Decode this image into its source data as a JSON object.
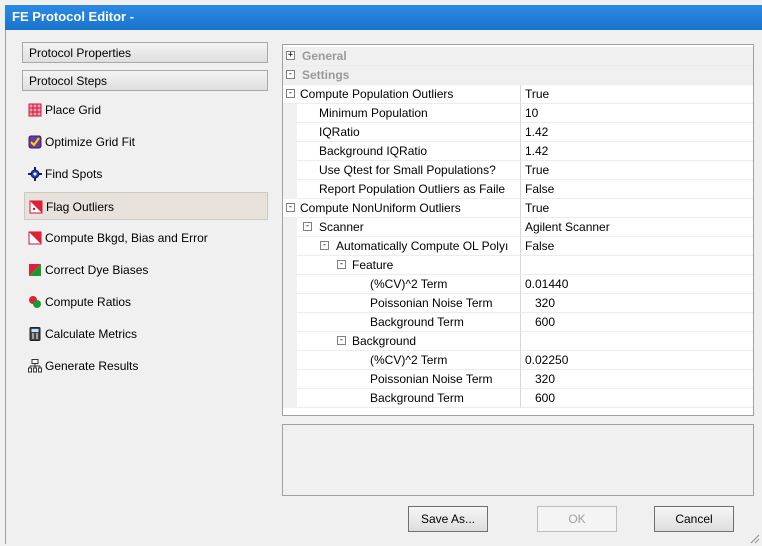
{
  "window": {
    "title": "FE Protocol Editor -"
  },
  "left_panel": {
    "protocol_properties": "Protocol Properties",
    "protocol_steps": "Protocol Steps",
    "steps": [
      {
        "label": "Place Grid",
        "icon": "place-grid-icon",
        "selected": false
      },
      {
        "label": "Optimize Grid Fit",
        "icon": "optimize-grid-icon",
        "selected": false
      },
      {
        "label": "Find Spots",
        "icon": "find-spots-icon",
        "selected": false
      },
      {
        "label": "Flag Outliers",
        "icon": "flag-outliers-icon",
        "selected": true
      },
      {
        "label": "Compute Bkgd, Bias and Error",
        "icon": "compute-bkgd-icon",
        "selected": false
      },
      {
        "label": "Correct Dye Biases",
        "icon": "correct-dye-icon",
        "selected": false
      },
      {
        "label": "Compute Ratios",
        "icon": "compute-ratios-icon",
        "selected": false
      },
      {
        "label": "Calculate Metrics",
        "icon": "calculate-metrics-icon",
        "selected": false
      },
      {
        "label": "Generate Results",
        "icon": "generate-results-icon",
        "selected": false
      }
    ]
  },
  "grid": {
    "rows": [
      {
        "name": "General",
        "value": "",
        "type": "category",
        "toggle": "+"
      },
      {
        "name": "Settings",
        "value": "",
        "type": "category",
        "toggle": "-"
      },
      {
        "name": "Compute Population Outliers",
        "value": "True",
        "toggle": "-"
      },
      {
        "name": "Minimum Population",
        "value": "10"
      },
      {
        "name": "IQRatio",
        "value": "1.42"
      },
      {
        "name": "Background IQRatio",
        "value": "1.42"
      },
      {
        "name": "Use Qtest for Small Populations?",
        "value": "True"
      },
      {
        "name": "Report Population Outliers as Faile",
        "value": "False"
      },
      {
        "name": "Compute NonUniform Outliers",
        "value": "True",
        "toggle": "-"
      },
      {
        "name": "Scanner",
        "value": "Agilent Scanner",
        "toggle": "-"
      },
      {
        "name": "Automatically Compute OL Polyı",
        "value": "False",
        "toggle": "-"
      },
      {
        "name": "Feature",
        "value": "",
        "toggle": "-"
      },
      {
        "name": "(%CV)^2 Term",
        "value": "0.01440"
      },
      {
        "name": "Poissonian Noise Term",
        "value": "320"
      },
      {
        "name": "Background Term",
        "value": "600"
      },
      {
        "name": "Background",
        "value": "",
        "toggle": "-"
      },
      {
        "name": "(%CV)^2 Term",
        "value": "0.02250"
      },
      {
        "name": "Poissonian Noise Term",
        "value": "320"
      },
      {
        "name": "Background Term",
        "value": "600"
      }
    ]
  },
  "buttons": {
    "save_as": "Save As...",
    "ok": "OK",
    "cancel": "Cancel"
  }
}
